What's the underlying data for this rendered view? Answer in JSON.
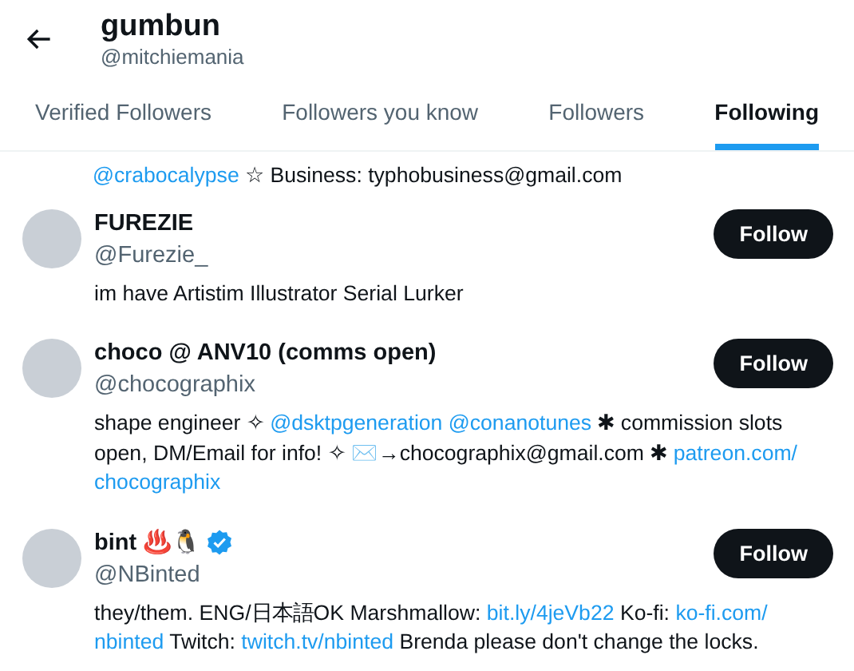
{
  "header": {
    "title": "gumbun",
    "handle": "@mitchiemania"
  },
  "tabs": [
    {
      "label": "Verified Followers",
      "selected": false
    },
    {
      "label": "Followers you know",
      "selected": false
    },
    {
      "label": "Followers",
      "selected": false
    },
    {
      "label": "Following",
      "selected": true
    }
  ],
  "fragment": [
    {
      "kind": "link",
      "text": "@crabocalypse"
    },
    {
      "kind": "text",
      "text": " ☆ Business: typhobusiness@gmail.com"
    }
  ],
  "users": [
    {
      "name": "FUREZIE",
      "handle": "@Furezie_",
      "verified": false,
      "button": "Follow",
      "bio": [
        {
          "kind": "text",
          "text": "im have Artistim Illustrator Serial Lurker"
        }
      ]
    },
    {
      "name": "choco @ ANV10 (comms open)",
      "handle": "@chocographix",
      "verified": false,
      "button": "Follow",
      "bio": [
        {
          "kind": "text",
          "text": "shape engineer ✧ "
        },
        {
          "kind": "link",
          "text": "@dsktpgeneration @conanotunes"
        },
        {
          "kind": "text",
          "text": " ✱ commission slots open, DM/Email for info! ✧ ✉️→chocographix@gmail.com ✱ "
        },
        {
          "kind": "link",
          "text": "patreon.com/"
        },
        {
          "kind": "link",
          "text": "chocographix"
        }
      ]
    },
    {
      "name": "bint ♨️🐧",
      "handle": "@NBinted",
      "verified": true,
      "button": "Follow",
      "bio": [
        {
          "kind": "text",
          "text": "they/them. ENG/日本語OK Marshmallow: "
        },
        {
          "kind": "link",
          "text": "bit.ly/4jeVb22"
        },
        {
          "kind": "text",
          "text": " Ko-fi: "
        },
        {
          "kind": "link",
          "text": "ko-fi.com/"
        },
        {
          "kind": "link",
          "text": "nbinted"
        },
        {
          "kind": "text",
          "text": " Twitch: "
        },
        {
          "kind": "link",
          "text": "twitch.tv/nbinted"
        },
        {
          "kind": "text",
          "text": " Brenda please don't change the locks."
        }
      ]
    }
  ]
}
